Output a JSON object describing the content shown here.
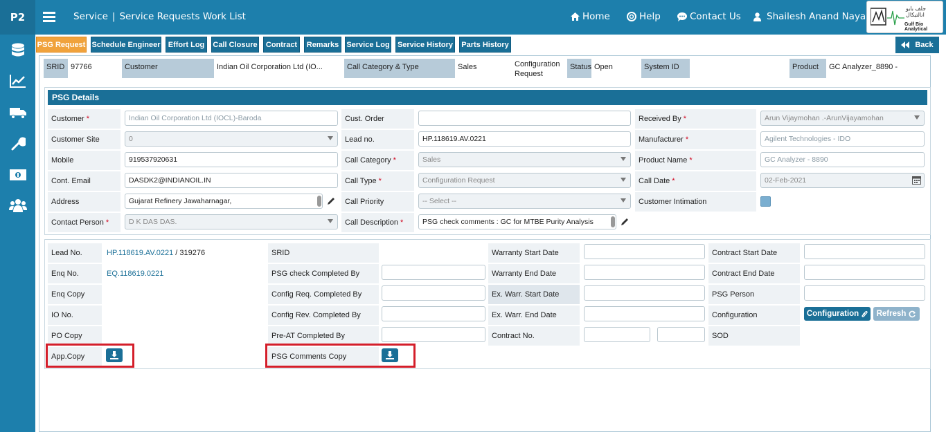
{
  "app": {
    "brand": "P2",
    "module": "Service",
    "page_title": "Service Requests Work List"
  },
  "topnav": {
    "home": "Home",
    "help": "Help",
    "contact": "Contact Us",
    "user": "Shailesh Anand Nayak"
  },
  "logo": {
    "name": "Gulf Bio Analytical",
    "arabic": "جلف بايو انالتيكال"
  },
  "tabs": [
    "PSG Request",
    "Schedule Engineer",
    "Effort Log",
    "Call Closure",
    "Contract",
    "Remarks",
    "Service Log",
    "Service History",
    "Parts History"
  ],
  "back_label": "Back",
  "summary": {
    "srid_label": "SRID",
    "srid": "97766",
    "customer_label": "Customer",
    "customer": "Indian Oil Corporation Ltd (IO...",
    "category_label": "Call Category & Type",
    "category": "Sales",
    "call_type": "Configuration Request",
    "status_label": "Status",
    "status": "Open",
    "system_label": "System ID",
    "system": "",
    "product_label": "Product",
    "product": "GC Analyzer_8890 -"
  },
  "psg": {
    "title": "PSG Details",
    "customer_label": "Customer",
    "customer": "Indian Oil Corporation Ltd (IOCL)-Baroda",
    "site_label": "Customer Site",
    "site": "0",
    "mobile_label": "Mobile",
    "mobile": "919537920631",
    "email_label": "Cont. Email",
    "email": "DASDK2@INDIANOIL.IN",
    "address_label": "Address",
    "address": "Gujarat Refinery Jawaharnagar,",
    "contact_label": "Contact Person",
    "contact": "D K DAS DAS.",
    "order_label": "Cust. Order",
    "order": "",
    "lead_label": "Lead no.",
    "lead": "HP.118619.AV.0221",
    "callcat_label": "Call Category",
    "callcat": "Sales",
    "calltype_label": "Call Type",
    "calltype": "Configuration Request",
    "priority_label": "Call Priority",
    "priority": "-- Select --",
    "desc_label": "Call Description",
    "desc": "PSG check comments : GC for MTBE Purity Analysis",
    "received_label": "Received By",
    "received": "Arun Vijaymohan .-ArunVijayamohan",
    "manufacturer_label": "Manufacturer",
    "manufacturer": "Agilent Technologies - IDO",
    "product_label": "Product Name",
    "product": "GC Analyzer - 8890",
    "calldate_label": "Call Date",
    "calldate": "02-Feb-2021",
    "intimation_label": "Customer Intimation"
  },
  "details": {
    "leadno_label": "Lead No.",
    "leadno": "HP.118619.AV.0221",
    "leadno_sep": " / ",
    "leadno_num": "319276",
    "enqno_label": "Enq No.",
    "enqno": "EQ.118619.0221",
    "enqcopy_label": "Enq Copy",
    "iono_label": "IO No.",
    "pocopy_label": "PO Copy",
    "appcopy_label": "App.Copy",
    "srid_label": "SRID",
    "psgcheck_label": "PSG check Completed By",
    "configreq_label": "Config Req. Completed By",
    "configrev_label": "Config Rev. Completed By",
    "preat_label": "Pre-AT Completed By",
    "psgcomments_label": "PSG Comments Copy",
    "wstart_label": "Warranty Start Date",
    "wend_label": "Warranty End Date",
    "exwstart_label": "Ex. Warr. Start Date",
    "exwend_label": "Ex. Warr. End Date",
    "contractno_label": "Contract No.",
    "cstart_label": "Contract Start Date",
    "cend_label": "Contract End Date",
    "psgperson_label": "PSG Person",
    "configuration_label": "Configuration",
    "sod_label": "SOD",
    "config_btn": "Configuration",
    "refresh_btn": "Refresh"
  }
}
